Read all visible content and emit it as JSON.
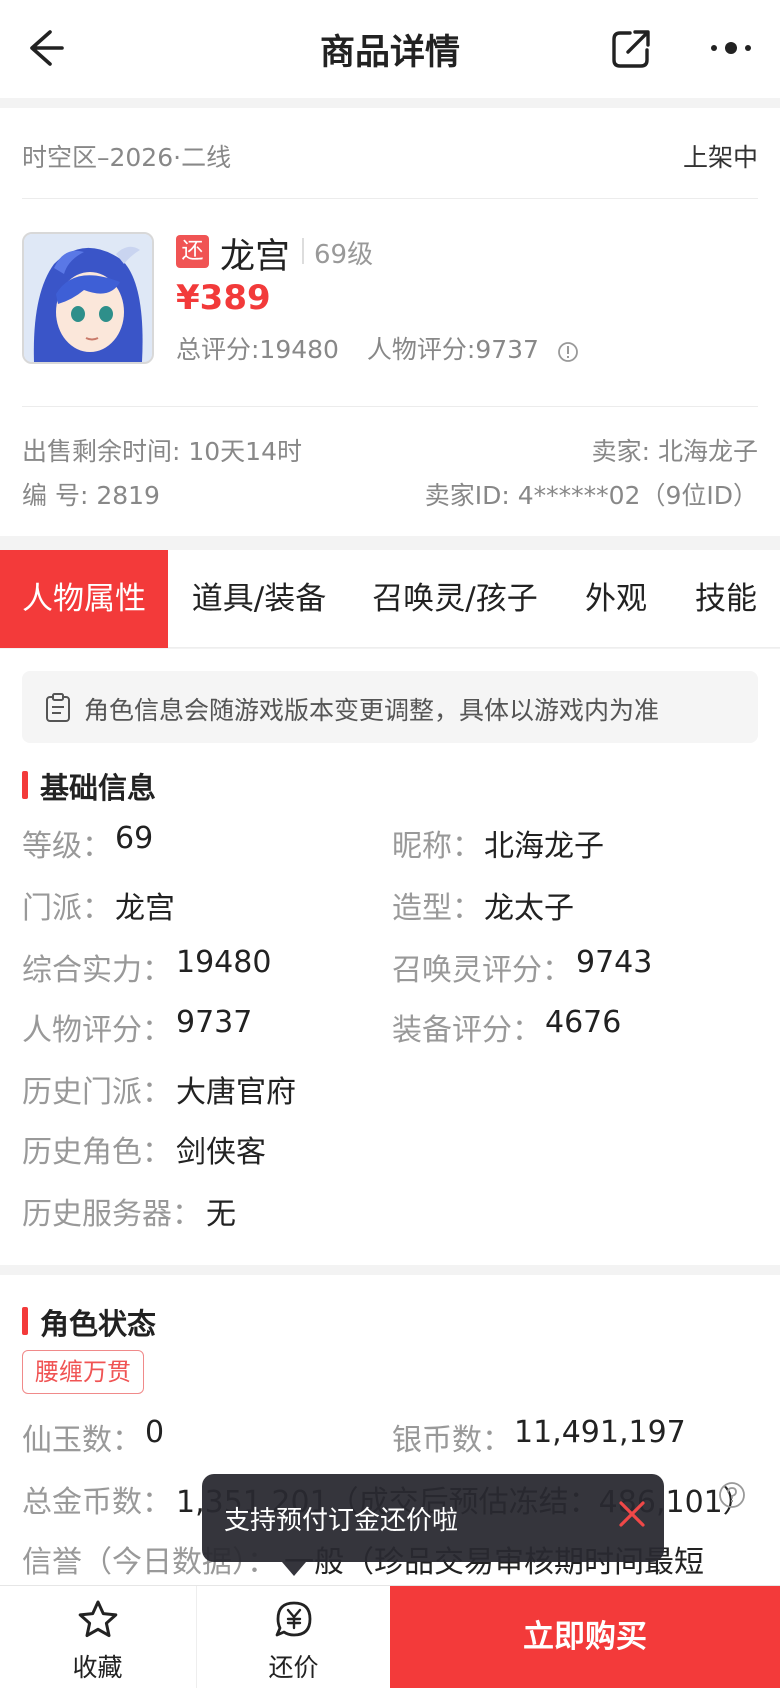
{
  "header": {
    "title": "商品详情"
  },
  "listing": {
    "server": "时空区–2026·二线",
    "status": "上架中",
    "badge": "还",
    "name": "龙宫",
    "level": "69级",
    "price": "¥389",
    "total_score": "总评分:19480",
    "char_score": "人物评分:9737",
    "time_left": "出售剩余时间: 10天14时",
    "seller": "卖家: 北海龙子",
    "number": "编 号: 2819",
    "seller_id": "卖家ID: 4******02（9位ID）"
  },
  "tabs": [
    "人物属性",
    "道具/装备",
    "召唤灵/孩子",
    "外观",
    "技能"
  ],
  "notice": "角色信息会随游戏版本变更调整，具体以游戏内为准",
  "basic": {
    "title": "基础信息",
    "fields": [
      {
        "label": "等级：",
        "value": "69"
      },
      {
        "label": "昵称：",
        "value": "北海龙子"
      },
      {
        "label": "门派：",
        "value": "龙宫"
      },
      {
        "label": "造型：",
        "value": "龙太子"
      },
      {
        "label": "综合实力：",
        "value": "19480"
      },
      {
        "label": "召唤灵评分：",
        "value": "9743"
      },
      {
        "label": "人物评分：",
        "value": "9737"
      },
      {
        "label": "装备评分：",
        "value": "4676"
      },
      {
        "label": "历史门派：",
        "value": "大唐官府"
      },
      {
        "label": "历史角色：",
        "value": "剑侠客"
      },
      {
        "label": "历史服务器：",
        "value": "无"
      }
    ]
  },
  "status": {
    "title": "角色状态",
    "tag": "腰缠万贯",
    "fields": [
      {
        "label": "仙玉数：",
        "value": "0"
      },
      {
        "label": "银币数：",
        "value": "11,491,197"
      },
      {
        "label": "总金币数：",
        "value": "1,351,201（成交后预估冻结：486,101）"
      },
      {
        "label": "信誉（今日数据）：",
        "value": "一般（珍品交易审核期时间最短"
      }
    ]
  },
  "toast": {
    "text": "支持预付订金还价啦"
  },
  "bottom": {
    "favorite": "收藏",
    "bargain": "还价",
    "buy": "立即购买"
  }
}
